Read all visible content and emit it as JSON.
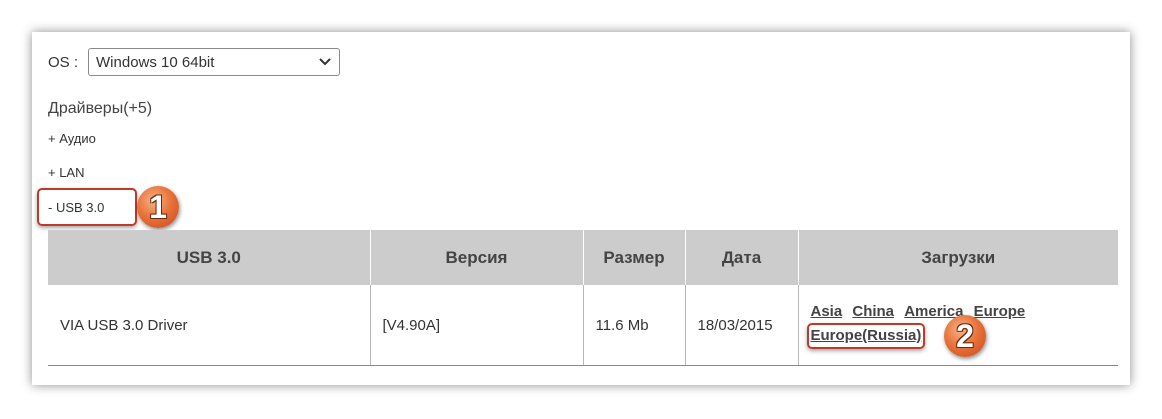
{
  "os": {
    "label": "OS :",
    "selected": "Windows 10 64bit"
  },
  "drivers": {
    "title": "Драйверы(+5)",
    "categories": [
      {
        "label": "+ Аудио"
      },
      {
        "label": "+ LAN"
      },
      {
        "label": "- USB 3.0"
      }
    ]
  },
  "table": {
    "headers": [
      "USB 3.0",
      "Версия",
      "Размер",
      "Дата",
      "Загрузки"
    ],
    "rows": [
      {
        "name": "VIA USB 3.0 Driver",
        "version": "[V4.90A]",
        "size": "11.6 Mb",
        "date": "18/03/2015",
        "downloads": [
          "Asia",
          "China",
          "America",
          "Europe",
          "Europe(Russia)"
        ]
      }
    ]
  },
  "annotations": {
    "step1": "1",
    "step2": "2",
    "highlight_color": "#c0392b",
    "badge_color": "#e8743b"
  }
}
